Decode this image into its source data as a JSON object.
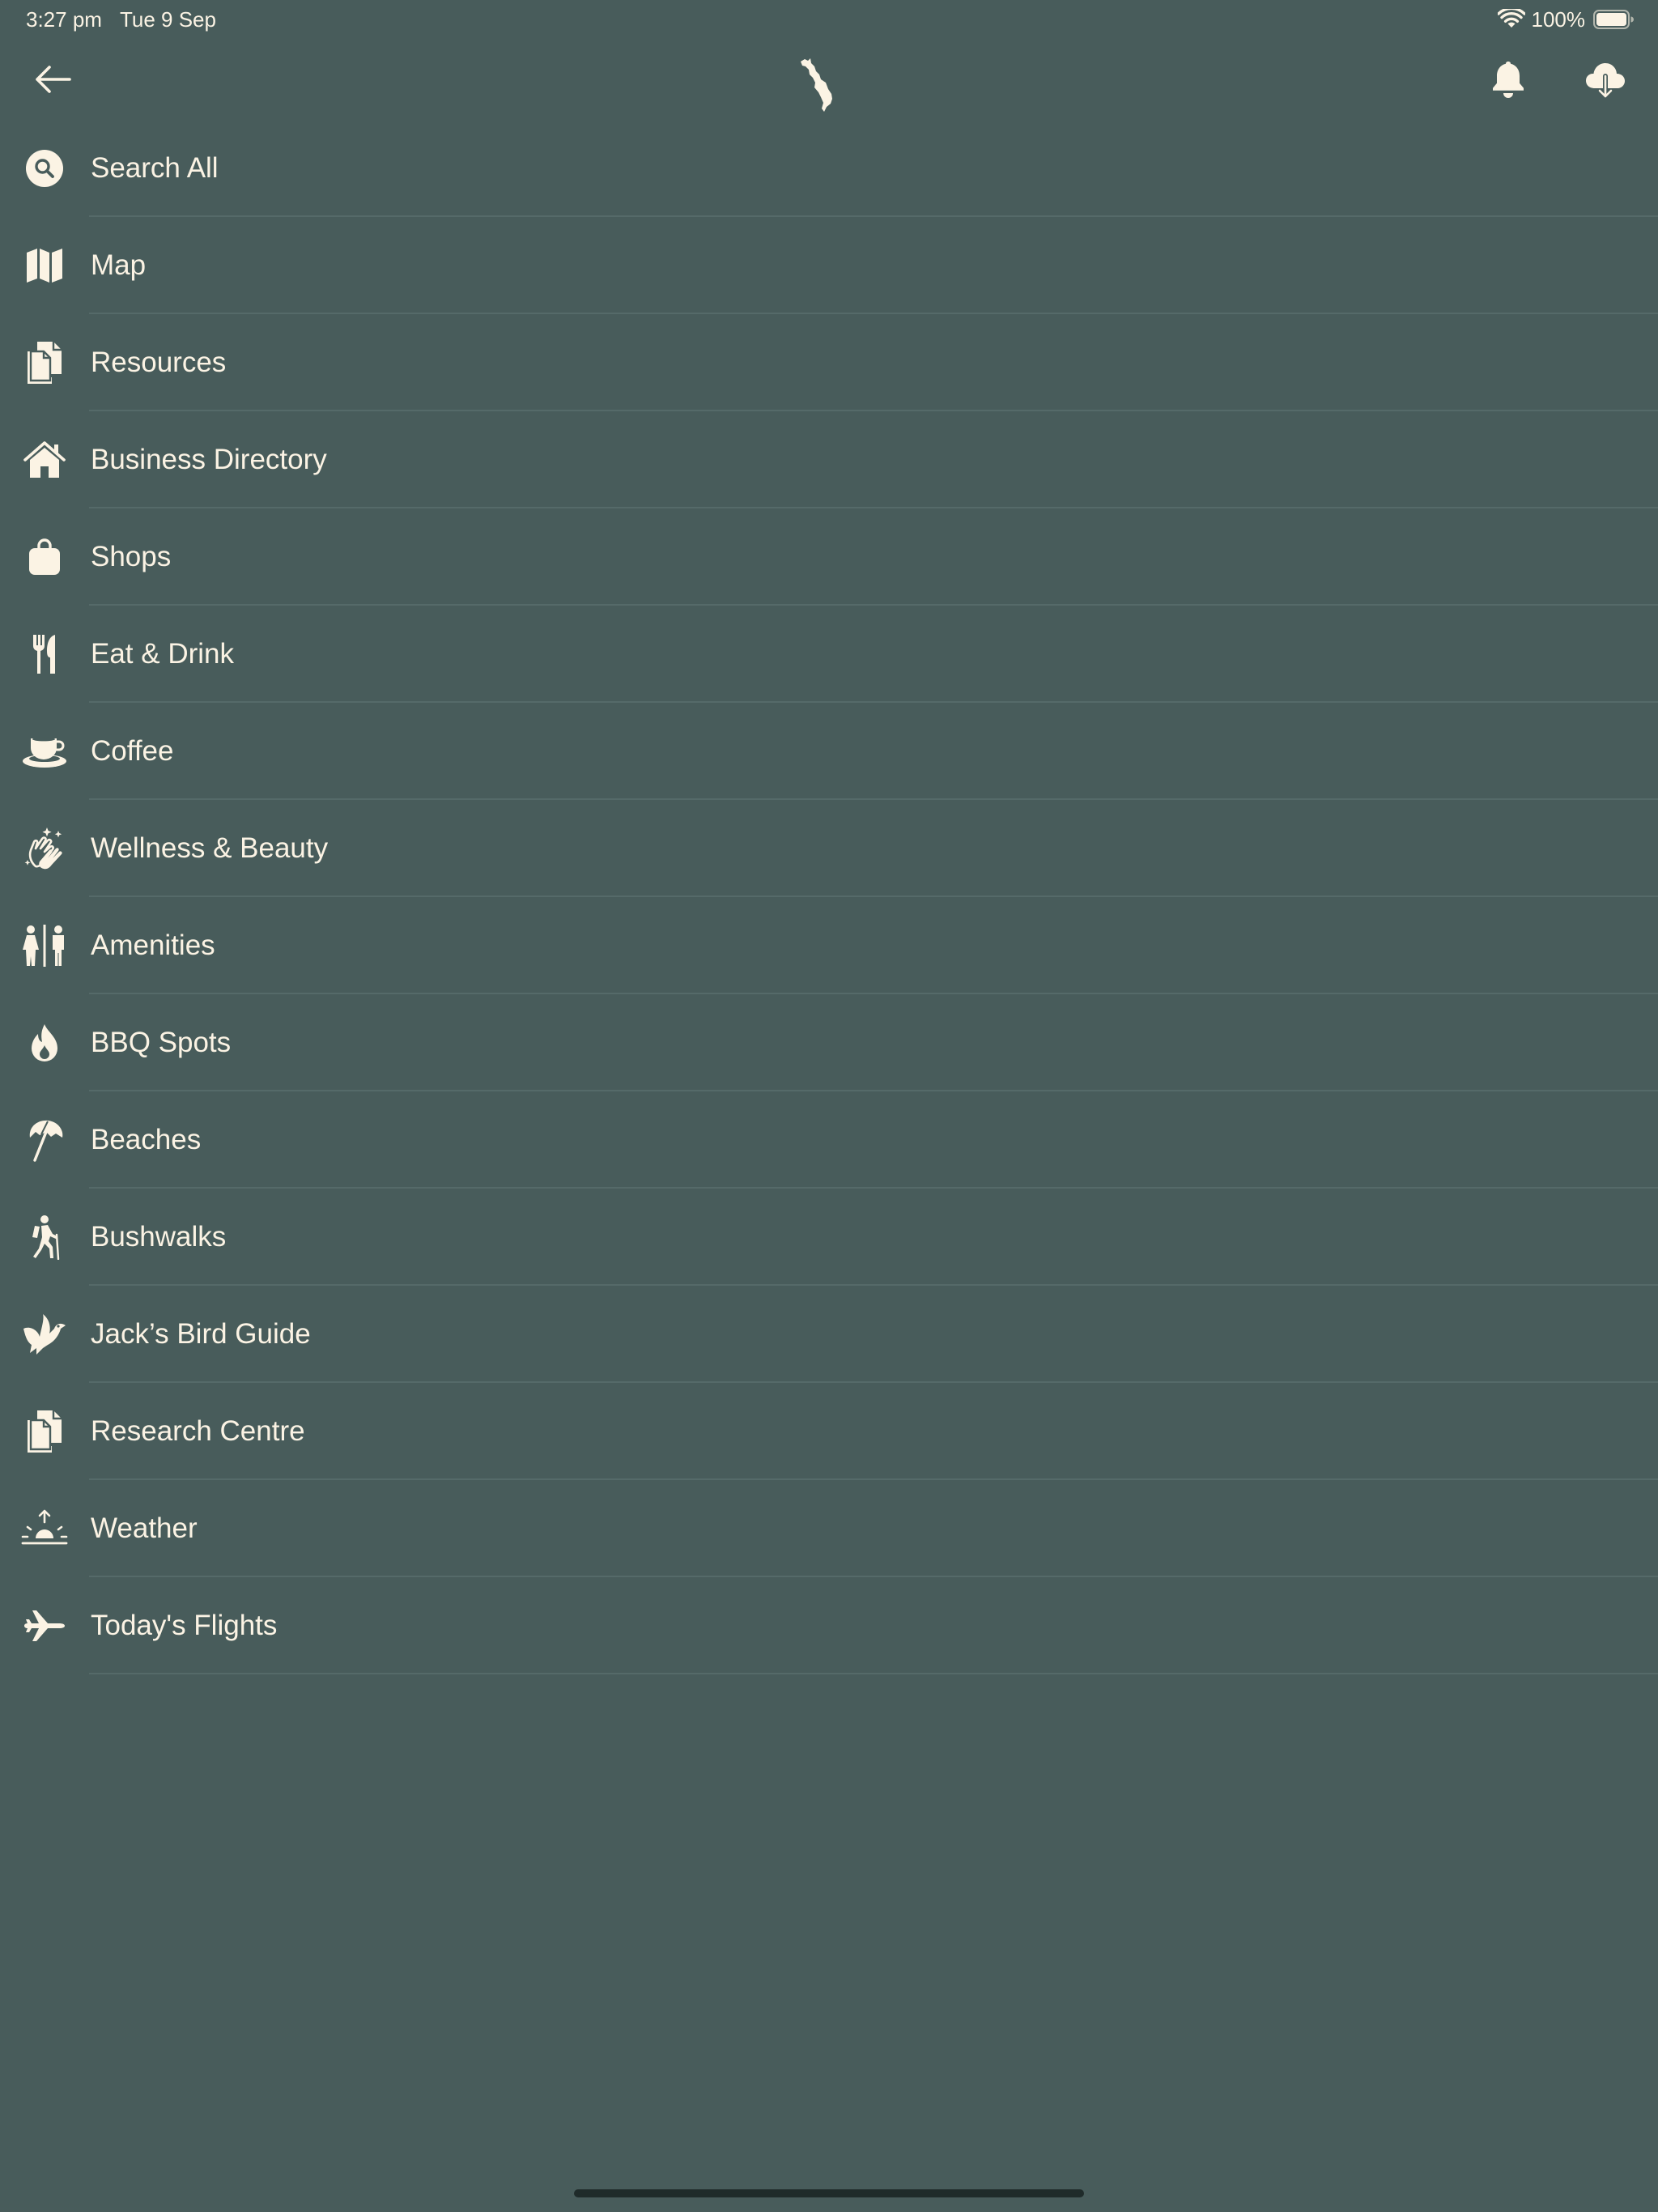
{
  "colors": {
    "background": "#485c5b",
    "foreground": "#fbf3e4",
    "separator": "#556a69"
  },
  "status_bar": {
    "time": "3:27 pm",
    "date": "Tue 9 Sep",
    "battery_percent": "100%",
    "icons": [
      "wifi-icon",
      "battery-icon"
    ]
  },
  "nav_bar": {
    "back_icon": "arrow-left-icon",
    "logo_icon": "island-logo-icon",
    "notification_icon": "bell-icon",
    "download_icon": "cloud-download-icon"
  },
  "menu": {
    "items": [
      {
        "label": "Search All",
        "icon": "search-icon"
      },
      {
        "label": "Map",
        "icon": "map-icon"
      },
      {
        "label": "Resources",
        "icon": "documents-icon"
      },
      {
        "label": "Business Directory",
        "icon": "house-icon"
      },
      {
        "label": "Shops",
        "icon": "shopping-bag-icon"
      },
      {
        "label": "Eat & Drink",
        "icon": "fork-knife-icon"
      },
      {
        "label": "Coffee",
        "icon": "coffee-cup-icon"
      },
      {
        "label": "Wellness & Beauty",
        "icon": "clapping-hands-sparkle-icon"
      },
      {
        "label": "Amenities",
        "icon": "restroom-icon"
      },
      {
        "label": "BBQ Spots",
        "icon": "flame-icon"
      },
      {
        "label": "Beaches",
        "icon": "beach-umbrella-icon"
      },
      {
        "label": "Bushwalks",
        "icon": "hiker-icon"
      },
      {
        "label": "Jack’s Bird Guide",
        "icon": "bird-icon"
      },
      {
        "label": "Research Centre",
        "icon": "documents-icon"
      },
      {
        "label": "Weather",
        "icon": "sunrise-icon"
      },
      {
        "label": "Today's Flights",
        "icon": "airplane-icon"
      }
    ]
  }
}
